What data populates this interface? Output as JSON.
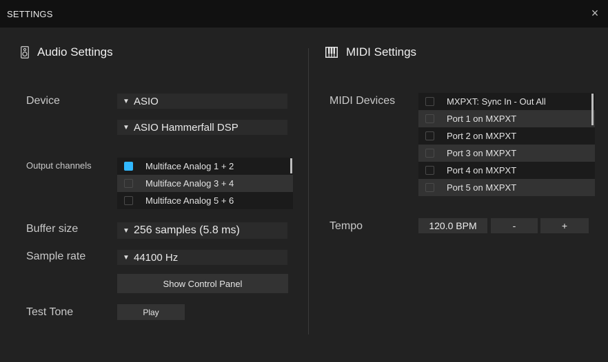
{
  "window": {
    "title": "SETTINGS",
    "close_glyph": "×"
  },
  "audio": {
    "header": "Audio Settings",
    "icon": "speaker-icon",
    "device_label": "Device",
    "device_type": "ASIO",
    "device_name": "ASIO Hammerfall DSP",
    "output_label": "Output channels",
    "output_channels": [
      {
        "label": "Multiface Analog 1 + 2",
        "checked": true
      },
      {
        "label": "Multiface Analog 3 + 4",
        "checked": false
      },
      {
        "label": "Multiface Analog 5 + 6",
        "checked": false
      }
    ],
    "buffer_label": "Buffer size",
    "buffer_value": "256 samples (5.8 ms)",
    "rate_label": "Sample rate",
    "rate_value": "44100 Hz",
    "control_panel_button": "Show Control Panel",
    "test_tone_label": "Test Tone",
    "play_button": "Play"
  },
  "midi": {
    "header": "MIDI Settings",
    "icon": "piano-keys-icon",
    "devices_label": "MIDI Devices",
    "devices": [
      {
        "label": "MXPXT: Sync In - Out All",
        "checked": false
      },
      {
        "label": "Port 1 on MXPXT",
        "checked": false
      },
      {
        "label": "Port 2 on MXPXT",
        "checked": false
      },
      {
        "label": "Port 3 on MXPXT",
        "checked": false
      },
      {
        "label": "Port 4 on MXPXT",
        "checked": false
      },
      {
        "label": "Port 5 on MXPXT",
        "checked": false
      }
    ],
    "tempo_label": "Tempo",
    "tempo_value": "120.0 BPM",
    "tempo_minus": "-",
    "tempo_plus": "+"
  },
  "colors": {
    "accent": "#31b8ff",
    "background": "#222222",
    "titlebar": "#111111"
  }
}
